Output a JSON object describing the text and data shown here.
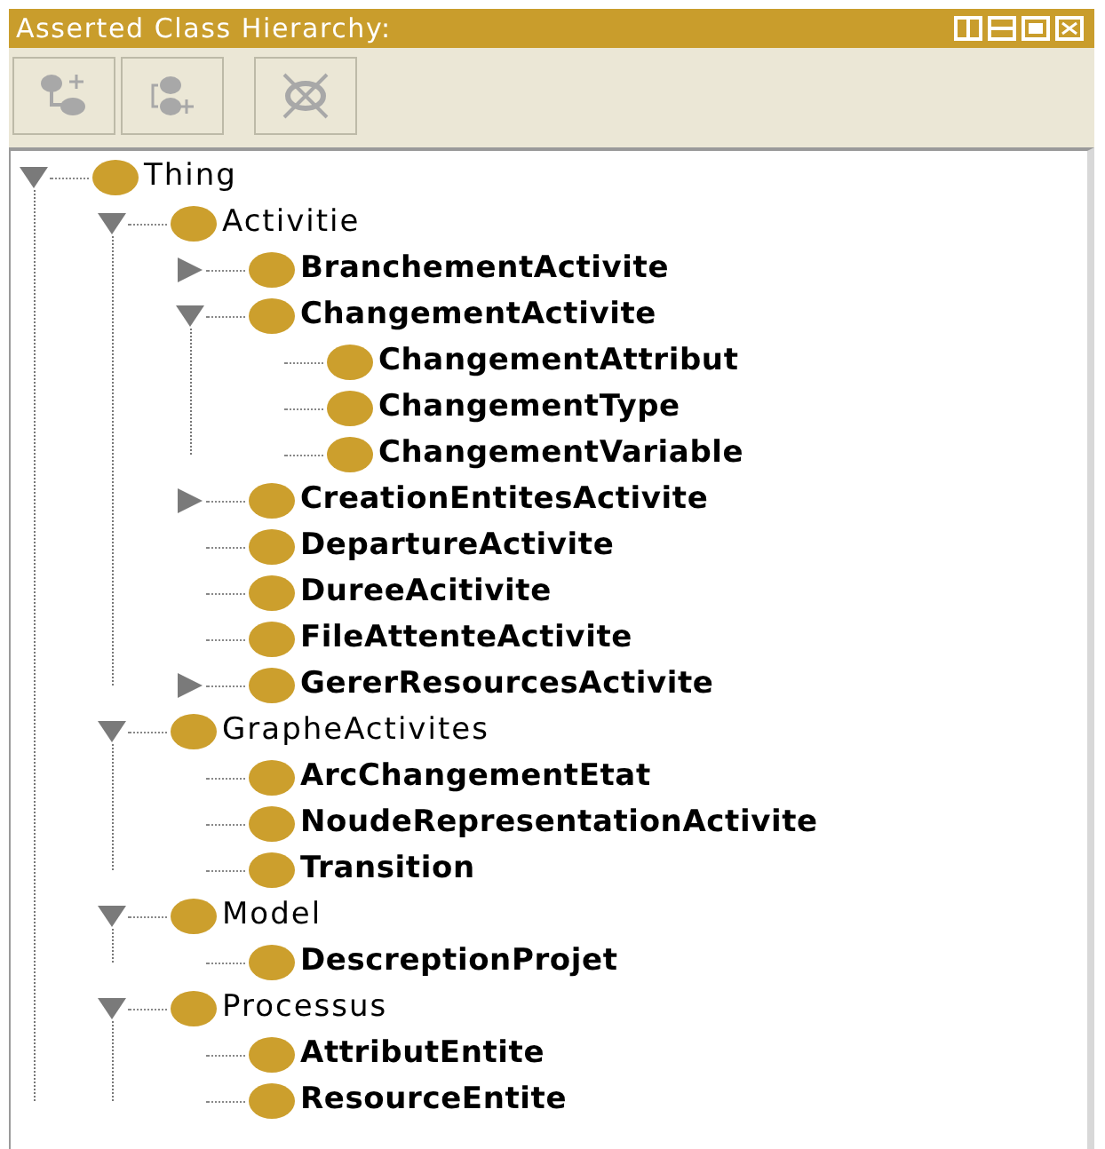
{
  "panel": {
    "title": "Asserted Class Hierarchy:"
  },
  "toolbar": {
    "buttons": [
      {
        "kind": "add-subclass",
        "disabled": true
      },
      {
        "kind": "add-sibling",
        "disabled": true
      },
      {
        "kind": "delete",
        "disabled": true
      }
    ]
  },
  "tree": [
    {
      "label": "Thing",
      "bold": false,
      "expanded": true,
      "children": [
        {
          "label": "Activitie",
          "bold": false,
          "expanded": true,
          "children": [
            {
              "label": "BranchementActivite",
              "bold": true,
              "expanded": false
            },
            {
              "label": "ChangementActivite",
              "bold": true,
              "expanded": true,
              "children": [
                {
                  "label": "ChangementAttribut",
                  "bold": true
                },
                {
                  "label": "ChangementType",
                  "bold": true
                },
                {
                  "label": "ChangementVariable",
                  "bold": true
                }
              ]
            },
            {
              "label": "CreationEntitesActivite",
              "bold": true,
              "expanded": false
            },
            {
              "label": "DepartureActivite",
              "bold": true
            },
            {
              "label": "DureeAcitivite",
              "bold": true
            },
            {
              "label": "FileAttenteActivite",
              "bold": true
            },
            {
              "label": "GererResourcesActivite",
              "bold": true,
              "expanded": false
            }
          ]
        },
        {
          "label": "GrapheActivites",
          "bold": false,
          "expanded": true,
          "children": [
            {
              "label": "ArcChangementEtat",
              "bold": true
            },
            {
              "label": "NoudeRepresentationActivite",
              "bold": true
            },
            {
              "label": "Transition",
              "bold": true
            }
          ]
        },
        {
          "label": "Model",
          "bold": false,
          "expanded": true,
          "children": [
            {
              "label": "DescreptionProjet",
              "bold": true
            }
          ]
        },
        {
          "label": "Processus",
          "bold": false,
          "expanded": true,
          "children": [
            {
              "label": "AttributEntite",
              "bold": true
            },
            {
              "label": "ResourceEntite",
              "bold": true
            }
          ]
        }
      ]
    }
  ]
}
